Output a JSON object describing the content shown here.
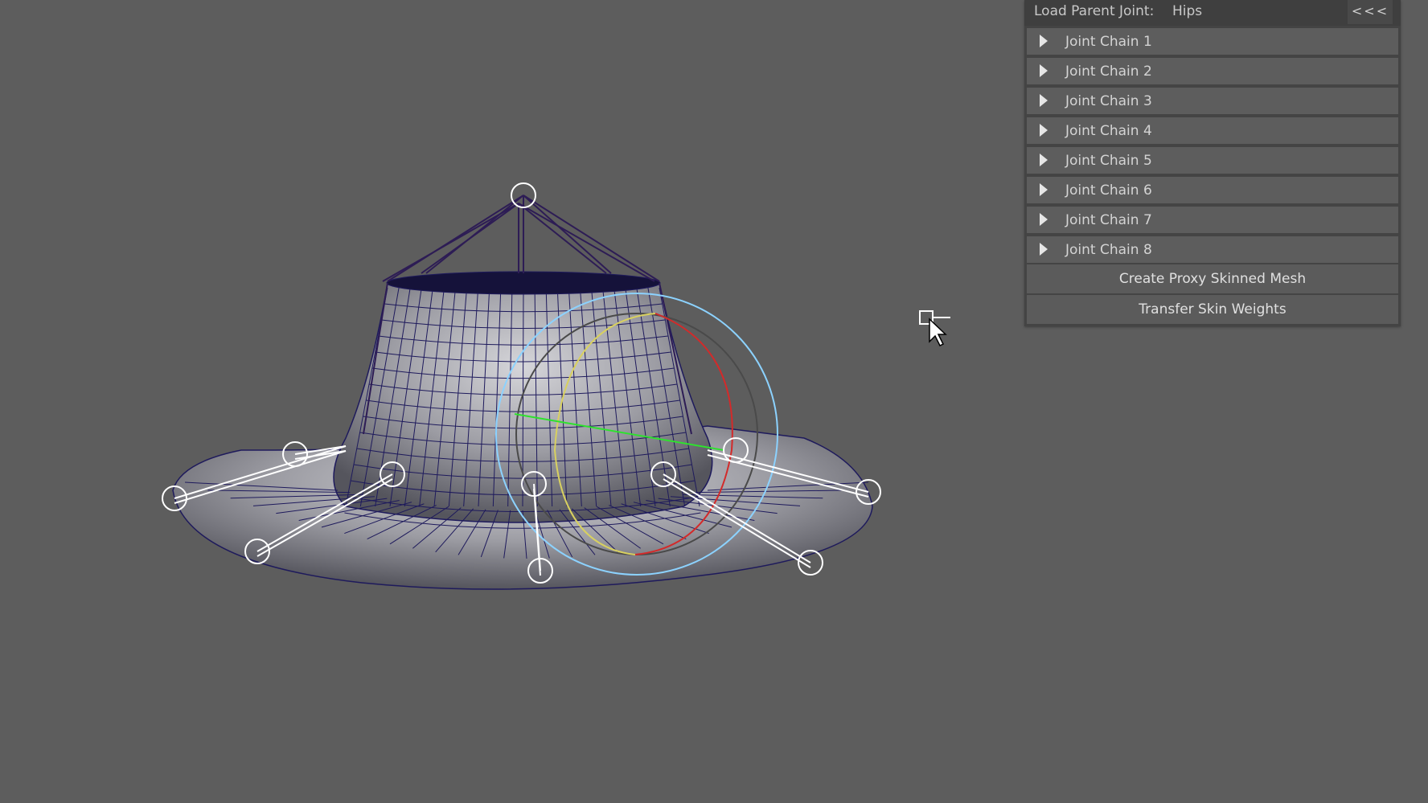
{
  "panel": {
    "load_parent_label": "Load Parent Joint:",
    "load_parent_value": "Hips",
    "collapse_label": "<<<",
    "joint_chains": [
      {
        "label": "Joint Chain 1"
      },
      {
        "label": "Joint Chain 2"
      },
      {
        "label": "Joint Chain 3"
      },
      {
        "label": "Joint Chain 4"
      },
      {
        "label": "Joint Chain 5"
      },
      {
        "label": "Joint Chain 6"
      },
      {
        "label": "Joint Chain 7"
      },
      {
        "label": "Joint Chain 8"
      }
    ],
    "create_proxy_label": "Create Proxy Skinned Mesh",
    "transfer_weights_label": "Transfer Skin Weights"
  },
  "colors": {
    "viewport_bg": "#5d5d5d",
    "wire": "#1e1a5c",
    "joint": "#ffffff",
    "bone": "#2d1c55",
    "rotate_x": "#d32a2a",
    "rotate_y": "#d8d060",
    "rotate_z": "#8cd2ff",
    "axis_green": "#2ee22e"
  },
  "icons": [
    "expand-triangle-icon",
    "mouse-cursor-icon",
    "selection-box-icon"
  ]
}
